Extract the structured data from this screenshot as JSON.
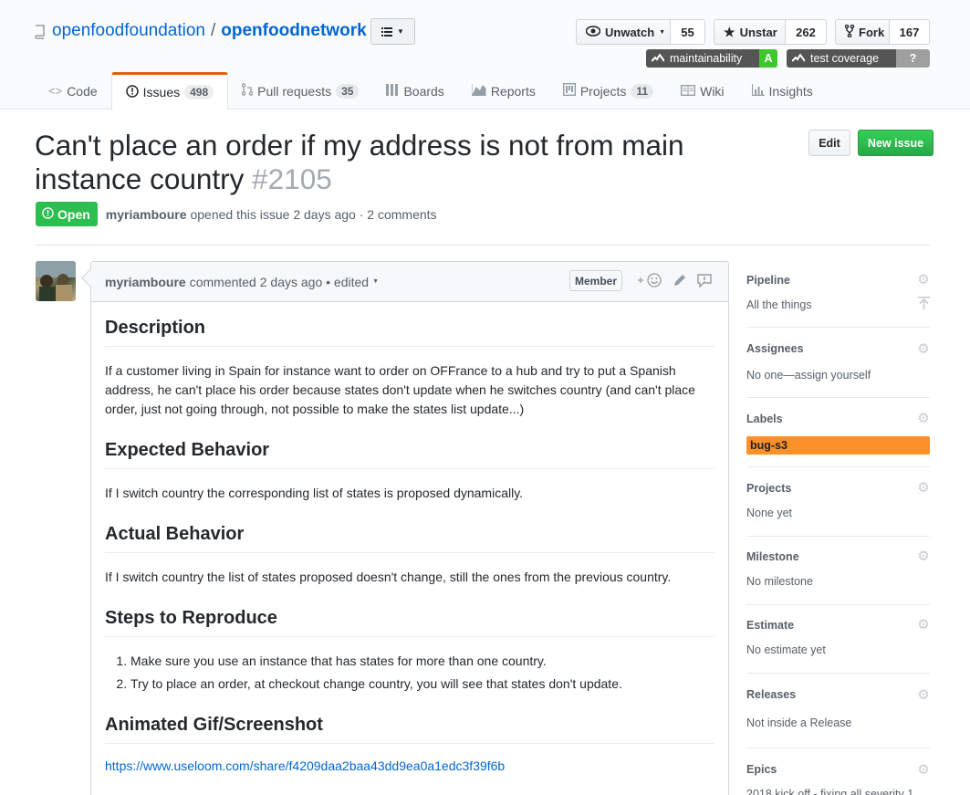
{
  "repo": {
    "owner": "openfoodfoundation",
    "separator": "/",
    "name": "openfoodnetwork"
  },
  "actions": {
    "watch": {
      "label": "Unwatch",
      "count": "55"
    },
    "star": {
      "label": "Unstar",
      "count": "262"
    },
    "fork": {
      "label": "Fork",
      "count": "167"
    }
  },
  "badges": {
    "maintainability": {
      "label": "maintainability",
      "value": "A",
      "color": "#3ec82e"
    },
    "coverage": {
      "label": "test coverage",
      "value": "?",
      "color": "#9f9f9f"
    }
  },
  "tabs": [
    {
      "label": "Code",
      "icon": "code-icon"
    },
    {
      "label": "Issues",
      "count": "498",
      "icon": "issue-opened-icon"
    },
    {
      "label": "Pull requests",
      "count": "35",
      "icon": "git-pull-request-icon"
    },
    {
      "label": "Boards",
      "icon": "boards-icon"
    },
    {
      "label": "Reports",
      "icon": "graph-icon"
    },
    {
      "label": "Projects",
      "count": "11",
      "icon": "project-icon"
    },
    {
      "label": "Wiki",
      "icon": "book-icon"
    },
    {
      "label": "Insights",
      "icon": "insights-icon"
    }
  ],
  "issue": {
    "title": "Can't place an order if my address is not from main instance country",
    "number": "#2105",
    "state": "Open",
    "author": "myriamboure",
    "opened_text": "opened this issue 2 days ago · 2 comments",
    "edit_label": "Edit",
    "new_issue_label": "New issue"
  },
  "comment": {
    "author": "myriamboure",
    "meta": "commented 2 days ago • edited",
    "role": "Member",
    "sections": [
      {
        "heading": "Description",
        "text": "If a customer living in Spain for instance want to order on OFFrance to a hub and try to put a Spanish address, he can't place his order because states don't update when he switches country (and can't place order, just not going through, not possible to make the states list update...)"
      },
      {
        "heading": "Expected Behavior",
        "text": "If I switch country the corresponding list of states is proposed dynamically."
      },
      {
        "heading": "Actual Behavior",
        "text": "If I switch country the list of states proposed doesn't change, still the ones from the previous country."
      },
      {
        "heading": "Steps to Reproduce",
        "steps": [
          "Make sure you use an instance that has states for more than one country.",
          "Try to place an order, at checkout change country, you will see that states don't update."
        ]
      },
      {
        "heading": "Animated Gif/Screenshot",
        "link": "https://www.useloom.com/share/f4209daa2baa43dd9ea0a1edc3f39f6b"
      }
    ]
  },
  "sidebar": {
    "pipeline": {
      "heading": "Pipeline",
      "value": "All the things"
    },
    "assignees": {
      "heading": "Assignees",
      "value": "No one—assign yourself"
    },
    "labels": {
      "heading": "Labels",
      "value": "bug-s3",
      "color": "#fd9127"
    },
    "projects": {
      "heading": "Projects",
      "value": "None yet"
    },
    "milestone": {
      "heading": "Milestone",
      "value": "No milestone"
    },
    "estimate": {
      "heading": "Estimate",
      "value": "No estimate yet"
    },
    "releases": {
      "heading": "Releases",
      "value": "Not inside a Release"
    },
    "epics": {
      "heading": "Epics",
      "value": "2018 kick off - fixing all severity 1"
    }
  }
}
